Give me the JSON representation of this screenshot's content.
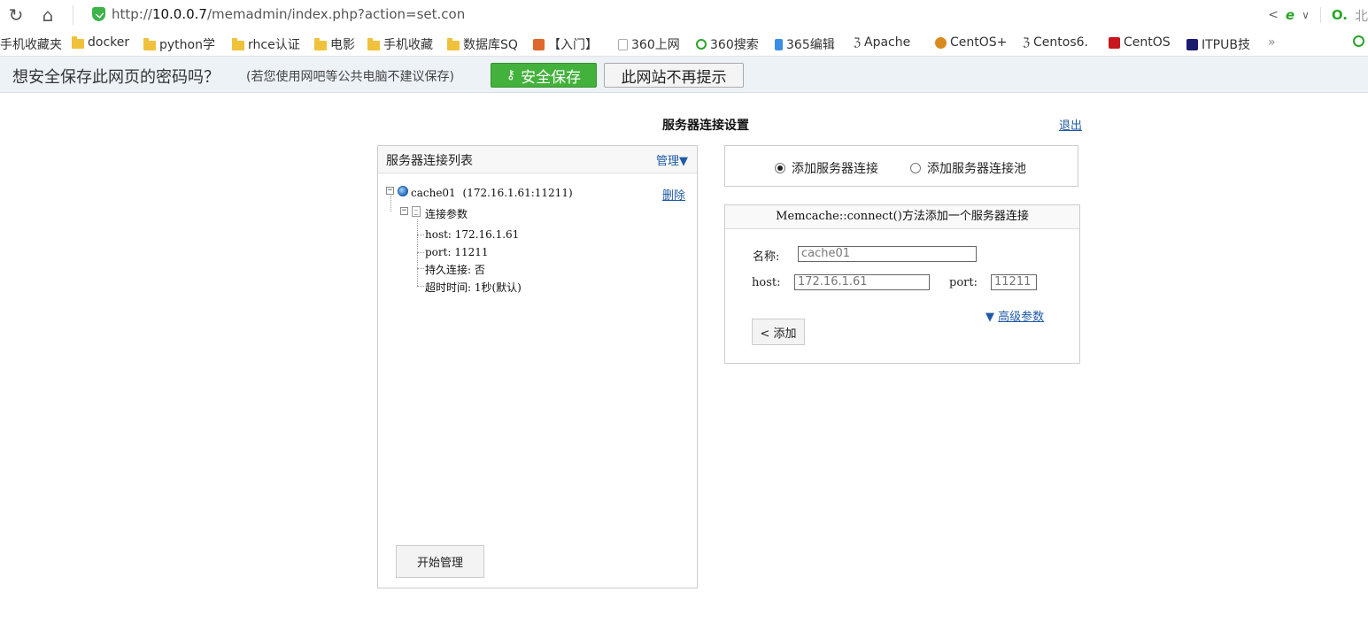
{
  "browser": {
    "url_prefix": "http://",
    "url_host": "10.0.0.7",
    "url_path": "/memadmin/index.php?action=set.con",
    "right_partial": "北",
    "bookmarks": [
      {
        "label": "手机收藏夹",
        "icon": "none"
      },
      {
        "label": "docker",
        "icon": "folder-icon"
      },
      {
        "label": "python学",
        "icon": "folder-icon"
      },
      {
        "label": "rhce认证",
        "icon": "folder-icon"
      },
      {
        "label": "电影",
        "icon": "folder-icon"
      },
      {
        "label": "手机收藏",
        "icon": "folder-icon"
      },
      {
        "label": "数据库SQ",
        "icon": "folder-icon"
      },
      {
        "label": "【入门】",
        "icon": "site-icon"
      },
      {
        "label": "360上网",
        "icon": "page-icon"
      },
      {
        "label": "360搜索",
        "icon": "site-icon"
      },
      {
        "label": "365编辑",
        "icon": "site-icon"
      },
      {
        "label": "Apache",
        "icon": "site-icon"
      },
      {
        "label": "CentOS+",
        "icon": "site-icon"
      },
      {
        "label": "Centos6.",
        "icon": "site-icon"
      },
      {
        "label": "CentOS",
        "icon": "site-icon"
      },
      {
        "label": "ITPUB技",
        "icon": "site-icon"
      }
    ],
    "more": "»"
  },
  "password_bar": {
    "question": "想安全保存此网页的密码吗？",
    "hint": "(若您使用网吧等公共电脑不建议保存)",
    "save_label": "安全保存",
    "never_label": "此网站不再提示"
  },
  "page": {
    "title": "服务器连接设置",
    "logout": "退出"
  },
  "left_panel": {
    "title": "服务器连接列表",
    "manage": "管理▼",
    "server_name": "cache01",
    "server_addr": "(172.16.1.61:11211)",
    "delete": "删除",
    "params_label": "连接参数",
    "params": [
      "host: 172.16.1.61",
      "port: 11211",
      "持久连接: 否",
      "超时时间: 1秒(默认)"
    ],
    "start_button": "开始管理"
  },
  "radio_options": {
    "add_server": "添加服务器连接",
    "add_pool": "添加服务器连接池",
    "selected": "add_server"
  },
  "form": {
    "header": "Memcache::connect()方法添加一个服务器连接",
    "name_label": "名称:",
    "name_value": "cache01",
    "host_label": "host:",
    "host_value": "172.16.1.61",
    "port_label": "port:",
    "port_value": "11211",
    "advanced_arrow": "▼",
    "advanced": "高级参数",
    "add_button": "< 添加"
  }
}
